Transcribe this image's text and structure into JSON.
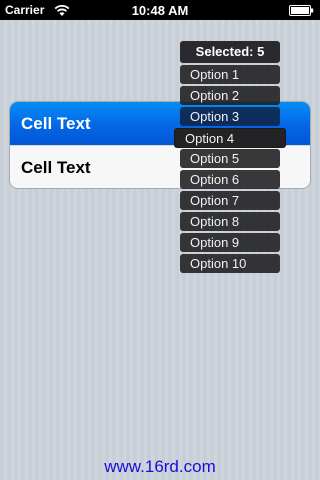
{
  "status_bar": {
    "carrier": "Carrier",
    "time": "10:48 AM",
    "wifi_icon": "wifi-icon",
    "battery_icon": "battery-icon"
  },
  "table": {
    "cells": [
      {
        "label": "Cell Text",
        "selected": true
      },
      {
        "label": "Cell Text",
        "selected": false
      }
    ]
  },
  "dropdown": {
    "header": "Selected: 5",
    "options": [
      "Option 1",
      "Option 2",
      "Option 3",
      "Option 4",
      "Option 5",
      "Option 6",
      "Option 7",
      "Option 8",
      "Option 9",
      "Option 10"
    ],
    "active_option": "Option 4"
  },
  "footer": {
    "link_text": "www.16rd.com"
  },
  "colors": {
    "selected_cell": "#0367e6",
    "pill_background": "#2a2a2e",
    "link": "#1a0dd8"
  }
}
